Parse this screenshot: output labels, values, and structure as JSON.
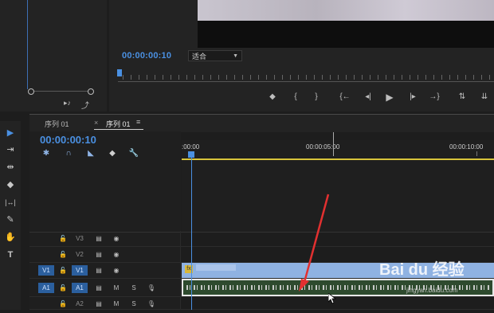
{
  "source_panel": {
    "buttons": [
      {
        "label": "▸♪",
        "icon": "insert-audio-icon"
      },
      {
        "label": "⤴",
        "icon": "export-frame-icon"
      }
    ]
  },
  "program_monitor": {
    "timecode": "00:00:00:10",
    "zoom": {
      "selected": "适合"
    },
    "transport": [
      {
        "label": "◆",
        "icon": "add-marker-icon"
      },
      {
        "label": "{",
        "icon": "mark-in-icon"
      },
      {
        "label": "}",
        "icon": "mark-out-icon"
      },
      {
        "label": "{←",
        "icon": "go-to-in-icon"
      },
      {
        "label": "◂|",
        "icon": "step-back-icon"
      },
      {
        "label": "▶",
        "icon": "play-icon"
      },
      {
        "label": "|▸",
        "icon": "step-forward-icon"
      },
      {
        "label": "→}",
        "icon": "go-to-out-icon"
      },
      {
        "label": "⇅",
        "icon": "lift-icon"
      },
      {
        "label": "⇊",
        "icon": "extract-icon"
      }
    ]
  },
  "timeline": {
    "tabs": [
      {
        "label": "序列 01"
      },
      {
        "label": "序列 01",
        "close": "×",
        "menu": "≡"
      }
    ],
    "timecode": "00:00:00:10",
    "header_tools": [
      {
        "label": "✱",
        "icon": "nest-sequence-icon"
      },
      {
        "label": "∩",
        "icon": "snap-icon"
      },
      {
        "label": "◣",
        "icon": "linked-selection-icon"
      },
      {
        "label": "◆",
        "icon": "add-marker-icon"
      },
      {
        "label": "🔧",
        "icon": "wrench-settings-icon"
      }
    ],
    "ruler_labels": [
      ":00:00",
      "00:00:05:00",
      "00:00:10:00"
    ],
    "tracks": [
      {
        "id": "v3",
        "src": "",
        "label": "V3",
        "type": "video"
      },
      {
        "id": "v2",
        "src": "",
        "label": "V2",
        "type": "video"
      },
      {
        "id": "v1",
        "src": "V1",
        "label": "V1",
        "type": "video"
      },
      {
        "id": "a1",
        "src": "A1",
        "label": "A1",
        "type": "audio",
        "m": "M",
        "s": "S"
      },
      {
        "id": "a2",
        "src": "",
        "label": "A2",
        "type": "audio",
        "m": "M",
        "s": "S"
      }
    ],
    "v1_clip": {
      "fx": "fx"
    }
  },
  "tools_panel": [
    {
      "label": "▶",
      "icon": "selection-tool-icon"
    },
    {
      "label": "⇥",
      "icon": "track-select-tool-icon"
    },
    {
      "label": "⇹",
      "icon": "ripple-edit-tool-icon"
    },
    {
      "label": "◆",
      "icon": "razor-tool-icon"
    },
    {
      "label": "|↔|",
      "icon": "slip-tool-icon"
    },
    {
      "label": "✎",
      "icon": "pen-tool-icon"
    },
    {
      "label": "✋",
      "icon": "hand-tool-icon"
    },
    {
      "label": "T",
      "icon": "type-tool-icon"
    }
  ],
  "watermark": {
    "text": "Bai du 经验",
    "url": "jingyan.baidu.com"
  },
  "colors": {
    "accent": "#4a90e2",
    "workarea": "#d8c43a",
    "video_clip": "#8fb2e2",
    "annotation_arrow": "#e23030"
  }
}
